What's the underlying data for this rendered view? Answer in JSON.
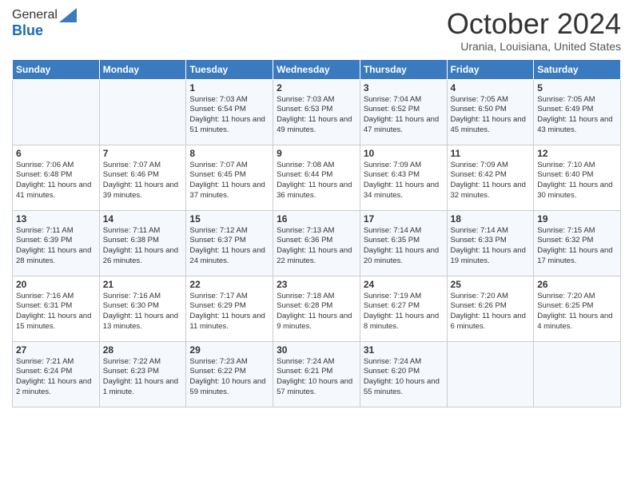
{
  "logo": {
    "general": "General",
    "blue": "Blue"
  },
  "header": {
    "month": "October 2024",
    "location": "Urania, Louisiana, United States"
  },
  "weekdays": [
    "Sunday",
    "Monday",
    "Tuesday",
    "Wednesday",
    "Thursday",
    "Friday",
    "Saturday"
  ],
  "weeks": [
    [
      {
        "day": "",
        "text": ""
      },
      {
        "day": "",
        "text": ""
      },
      {
        "day": "1",
        "text": "Sunrise: 7:03 AM\nSunset: 6:54 PM\nDaylight: 11 hours and 51 minutes."
      },
      {
        "day": "2",
        "text": "Sunrise: 7:03 AM\nSunset: 6:53 PM\nDaylight: 11 hours and 49 minutes."
      },
      {
        "day": "3",
        "text": "Sunrise: 7:04 AM\nSunset: 6:52 PM\nDaylight: 11 hours and 47 minutes."
      },
      {
        "day": "4",
        "text": "Sunrise: 7:05 AM\nSunset: 6:50 PM\nDaylight: 11 hours and 45 minutes."
      },
      {
        "day": "5",
        "text": "Sunrise: 7:05 AM\nSunset: 6:49 PM\nDaylight: 11 hours and 43 minutes."
      }
    ],
    [
      {
        "day": "6",
        "text": "Sunrise: 7:06 AM\nSunset: 6:48 PM\nDaylight: 11 hours and 41 minutes."
      },
      {
        "day": "7",
        "text": "Sunrise: 7:07 AM\nSunset: 6:46 PM\nDaylight: 11 hours and 39 minutes."
      },
      {
        "day": "8",
        "text": "Sunrise: 7:07 AM\nSunset: 6:45 PM\nDaylight: 11 hours and 37 minutes."
      },
      {
        "day": "9",
        "text": "Sunrise: 7:08 AM\nSunset: 6:44 PM\nDaylight: 11 hours and 36 minutes."
      },
      {
        "day": "10",
        "text": "Sunrise: 7:09 AM\nSunset: 6:43 PM\nDaylight: 11 hours and 34 minutes."
      },
      {
        "day": "11",
        "text": "Sunrise: 7:09 AM\nSunset: 6:42 PM\nDaylight: 11 hours and 32 minutes."
      },
      {
        "day": "12",
        "text": "Sunrise: 7:10 AM\nSunset: 6:40 PM\nDaylight: 11 hours and 30 minutes."
      }
    ],
    [
      {
        "day": "13",
        "text": "Sunrise: 7:11 AM\nSunset: 6:39 PM\nDaylight: 11 hours and 28 minutes."
      },
      {
        "day": "14",
        "text": "Sunrise: 7:11 AM\nSunset: 6:38 PM\nDaylight: 11 hours and 26 minutes."
      },
      {
        "day": "15",
        "text": "Sunrise: 7:12 AM\nSunset: 6:37 PM\nDaylight: 11 hours and 24 minutes."
      },
      {
        "day": "16",
        "text": "Sunrise: 7:13 AM\nSunset: 6:36 PM\nDaylight: 11 hours and 22 minutes."
      },
      {
        "day": "17",
        "text": "Sunrise: 7:14 AM\nSunset: 6:35 PM\nDaylight: 11 hours and 20 minutes."
      },
      {
        "day": "18",
        "text": "Sunrise: 7:14 AM\nSunset: 6:33 PM\nDaylight: 11 hours and 19 minutes."
      },
      {
        "day": "19",
        "text": "Sunrise: 7:15 AM\nSunset: 6:32 PM\nDaylight: 11 hours and 17 minutes."
      }
    ],
    [
      {
        "day": "20",
        "text": "Sunrise: 7:16 AM\nSunset: 6:31 PM\nDaylight: 11 hours and 15 minutes."
      },
      {
        "day": "21",
        "text": "Sunrise: 7:16 AM\nSunset: 6:30 PM\nDaylight: 11 hours and 13 minutes."
      },
      {
        "day": "22",
        "text": "Sunrise: 7:17 AM\nSunset: 6:29 PM\nDaylight: 11 hours and 11 minutes."
      },
      {
        "day": "23",
        "text": "Sunrise: 7:18 AM\nSunset: 6:28 PM\nDaylight: 11 hours and 9 minutes."
      },
      {
        "day": "24",
        "text": "Sunrise: 7:19 AM\nSunset: 6:27 PM\nDaylight: 11 hours and 8 minutes."
      },
      {
        "day": "25",
        "text": "Sunrise: 7:20 AM\nSunset: 6:26 PM\nDaylight: 11 hours and 6 minutes."
      },
      {
        "day": "26",
        "text": "Sunrise: 7:20 AM\nSunset: 6:25 PM\nDaylight: 11 hours and 4 minutes."
      }
    ],
    [
      {
        "day": "27",
        "text": "Sunrise: 7:21 AM\nSunset: 6:24 PM\nDaylight: 11 hours and 2 minutes."
      },
      {
        "day": "28",
        "text": "Sunrise: 7:22 AM\nSunset: 6:23 PM\nDaylight: 11 hours and 1 minute."
      },
      {
        "day": "29",
        "text": "Sunrise: 7:23 AM\nSunset: 6:22 PM\nDaylight: 10 hours and 59 minutes."
      },
      {
        "day": "30",
        "text": "Sunrise: 7:24 AM\nSunset: 6:21 PM\nDaylight: 10 hours and 57 minutes."
      },
      {
        "day": "31",
        "text": "Sunrise: 7:24 AM\nSunset: 6:20 PM\nDaylight: 10 hours and 55 minutes."
      },
      {
        "day": "",
        "text": ""
      },
      {
        "day": "",
        "text": ""
      }
    ]
  ]
}
